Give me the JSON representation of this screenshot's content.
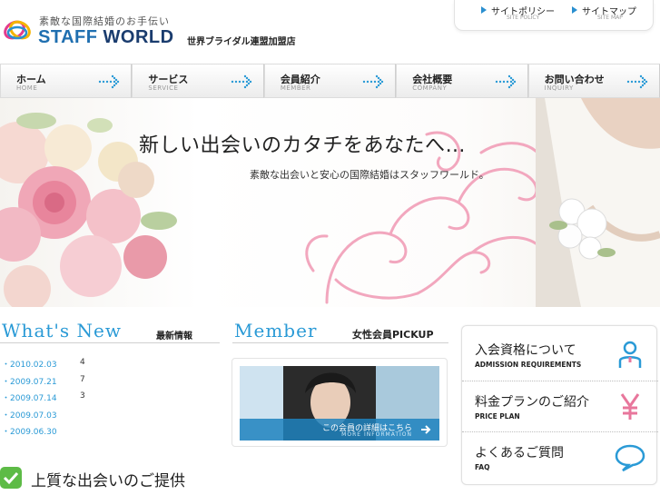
{
  "header": {
    "tagline": "素敵な国際結婚のお手伝い",
    "brand_first": "STAFF",
    "brand_second": "WORLD",
    "brand_sub": "世界ブライダル連盟加盟店",
    "logo_icon": "rings-logo-icon"
  },
  "utility_links": [
    {
      "label": "サイトポリシー",
      "sub": "SITE POLICY"
    },
    {
      "label": "サイトマップ",
      "sub": "SITE MAP"
    }
  ],
  "nav": [
    {
      "label": "ホーム",
      "sub": "HOME"
    },
    {
      "label": "サービス",
      "sub": "SERVICE"
    },
    {
      "label": "会員紹介",
      "sub": "MEMBER"
    },
    {
      "label": "会社概要",
      "sub": "COMPANY"
    },
    {
      "label": "お問い合わせ",
      "sub": "INQUIRY"
    }
  ],
  "hero": {
    "title": "新しい出会いのカタチをあなたへ…",
    "subtitle": "素敵な出会いと安心の国際結婚はスタッフワールド。"
  },
  "news": {
    "heading": "What's New",
    "heading_jp": "最新情報",
    "items": [
      {
        "date": "2010.02.03",
        "count": "4"
      },
      {
        "date": "2009.07.21",
        "count": "7"
      },
      {
        "date": "2009.07.14",
        "count": "3"
      },
      {
        "date": "2009.07.03",
        "count": ""
      },
      {
        "date": "2009.06.30",
        "count": ""
      }
    ]
  },
  "member": {
    "heading": "Member",
    "heading_jp": "女性会員PICKUP",
    "cta": "この会員の詳細はこちら",
    "cta_sub": "MORE INFORMATION"
  },
  "side_menu": [
    {
      "label": "入会資格について",
      "sub": "ADMISSION REQUIREMENTS",
      "icon": "person-icon"
    },
    {
      "label": "料金プランのご紹介",
      "sub": "PRICE PLAN",
      "icon": "yen-icon"
    },
    {
      "label": "よくあるご質問",
      "sub": "FAQ",
      "icon": "speech-bubble-icon"
    }
  ],
  "feature": {
    "title": "上質な出会いのご提供",
    "icon": "checkmark-icon"
  },
  "colors": {
    "accent_blue": "#2a9ad6",
    "brand_blue": "#1f6fb0",
    "pink": "#e8779c"
  }
}
